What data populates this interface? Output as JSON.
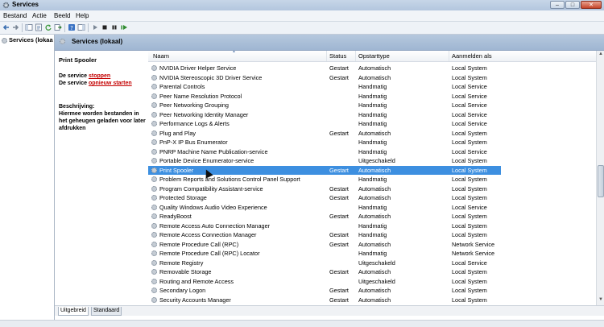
{
  "window": {
    "title": "Services",
    "minimize": "–",
    "maximize": "□",
    "close": "✕"
  },
  "menu": [
    "Bestand",
    "Actie",
    "Beeld",
    "Help"
  ],
  "tree": {
    "root_label": "Services (lokaal"
  },
  "header": {
    "title": "Services (lokaal)"
  },
  "description": {
    "service_name": "Print Spooler",
    "stop_prefix": "De service ",
    "stop_link": "stoppen",
    "restart_prefix": "De service ",
    "restart_link": "opnieuw starten",
    "desc_label": "Beschrijving:",
    "desc_text": "Hiermee worden bestanden in het geheugen geladen voor later afdrukken"
  },
  "columns": [
    "Naam",
    "Status",
    "Opstarttype",
    "Aanmelden als"
  ],
  "rows": [
    {
      "name": "NVIDIA Driver Helper Service",
      "status": "Gestart",
      "startup": "Automatisch",
      "logon": "Local System"
    },
    {
      "name": "NVIDIA Stereoscopic 3D Driver Service",
      "status": "Gestart",
      "startup": "Automatisch",
      "logon": "Local System"
    },
    {
      "name": "Parental Controls",
      "status": "",
      "startup": "Handmatig",
      "logon": "Local Service"
    },
    {
      "name": "Peer Name Resolution Protocol",
      "status": "",
      "startup": "Handmatig",
      "logon": "Local Service"
    },
    {
      "name": "Peer Networking Grouping",
      "status": "",
      "startup": "Handmatig",
      "logon": "Local Service"
    },
    {
      "name": "Peer Networking Identity Manager",
      "status": "",
      "startup": "Handmatig",
      "logon": "Local Service"
    },
    {
      "name": "Performance Logs & Alerts",
      "status": "",
      "startup": "Handmatig",
      "logon": "Local Service"
    },
    {
      "name": "Plug and Play",
      "status": "Gestart",
      "startup": "Automatisch",
      "logon": "Local System"
    },
    {
      "name": "PnP-X IP Bus Enumerator",
      "status": "",
      "startup": "Handmatig",
      "logon": "Local System"
    },
    {
      "name": "PNRP Machine Name Publication-service",
      "status": "",
      "startup": "Handmatig",
      "logon": "Local Service"
    },
    {
      "name": "Portable Device Enumerator-service",
      "status": "",
      "startup": "Uitgeschakeld",
      "logon": "Local System"
    },
    {
      "name": "Print Spooler",
      "status": "Gestart",
      "startup": "Automatisch",
      "logon": "Local System",
      "selected": true
    },
    {
      "name": "Problem Reports and Solutions Control Panel Support",
      "status": "",
      "startup": "Handmatig",
      "logon": "Local System"
    },
    {
      "name": "Program Compatibility Assistant-service",
      "status": "Gestart",
      "startup": "Automatisch",
      "logon": "Local System"
    },
    {
      "name": "Protected Storage",
      "status": "Gestart",
      "startup": "Automatisch",
      "logon": "Local System"
    },
    {
      "name": "Quality Windows Audio Video Experience",
      "status": "",
      "startup": "Handmatig",
      "logon": "Local Service"
    },
    {
      "name": "ReadyBoost",
      "status": "Gestart",
      "startup": "Automatisch",
      "logon": "Local System"
    },
    {
      "name": "Remote Access Auto Connection Manager",
      "status": "",
      "startup": "Handmatig",
      "logon": "Local System"
    },
    {
      "name": "Remote Access Connection Manager",
      "status": "Gestart",
      "startup": "Handmatig",
      "logon": "Local System"
    },
    {
      "name": "Remote Procedure Call (RPC)",
      "status": "Gestart",
      "startup": "Automatisch",
      "logon": "Network Service"
    },
    {
      "name": "Remote Procedure Call (RPC) Locator",
      "status": "",
      "startup": "Handmatig",
      "logon": "Network Service"
    },
    {
      "name": "Remote Registry",
      "status": "",
      "startup": "Uitgeschakeld",
      "logon": "Local Service"
    },
    {
      "name": "Removable Storage",
      "status": "Gestart",
      "startup": "Automatisch",
      "logon": "Local System"
    },
    {
      "name": "Routing and Remote Access",
      "status": "",
      "startup": "Uitgeschakeld",
      "logon": "Local System"
    },
    {
      "name": "Secondary Logon",
      "status": "Gestart",
      "startup": "Automatisch",
      "logon": "Local System"
    },
    {
      "name": "Security Accounts Manager",
      "status": "Gestart",
      "startup": "Automatisch",
      "logon": "Local System"
    }
  ],
  "tabs": [
    "Uitgebreid",
    "Standaard"
  ],
  "colors": {
    "selection": "#3d8fe0",
    "link": "#c40000",
    "header": "#9fb6d2"
  }
}
